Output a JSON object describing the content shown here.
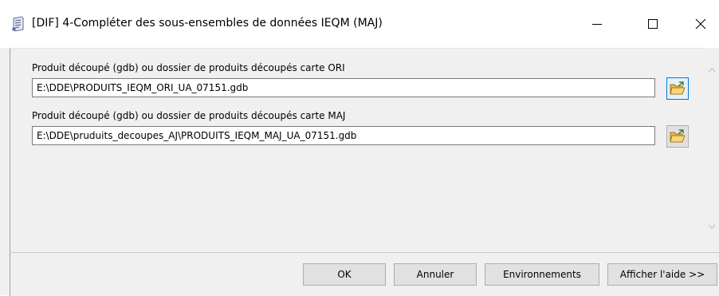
{
  "window": {
    "title": "[DIF] 4-Compléter des sous-ensembles de données IEQM (MAJ)",
    "icon": "script-tool-icon"
  },
  "fields": [
    {
      "label": "Produit découpé (gdb) ou dossier de produits découpés carte ORI",
      "value": "E:\\DDE\\PRODUITS_IEQM_ORI_UA_07151.gdb",
      "browse_icon": "open-folder-icon"
    },
    {
      "label": "Produit découpé (gdb) ou dossier de produits découpés carte MAJ",
      "value": "E:\\DDE\\pruduits_decoupes_AJ\\PRODUITS_IEQM_MAJ_UA_07151.gdb",
      "browse_icon": "open-folder-icon"
    }
  ],
  "buttons": {
    "ok": "OK",
    "cancel": "Annuler",
    "environments": "Environnements",
    "show_help": "Afficher l'aide >>"
  },
  "colors": {
    "titlebar_bg": "#ffffff",
    "dialog_bg": "#f0f0f0",
    "focus_blue": "#0078d7"
  }
}
